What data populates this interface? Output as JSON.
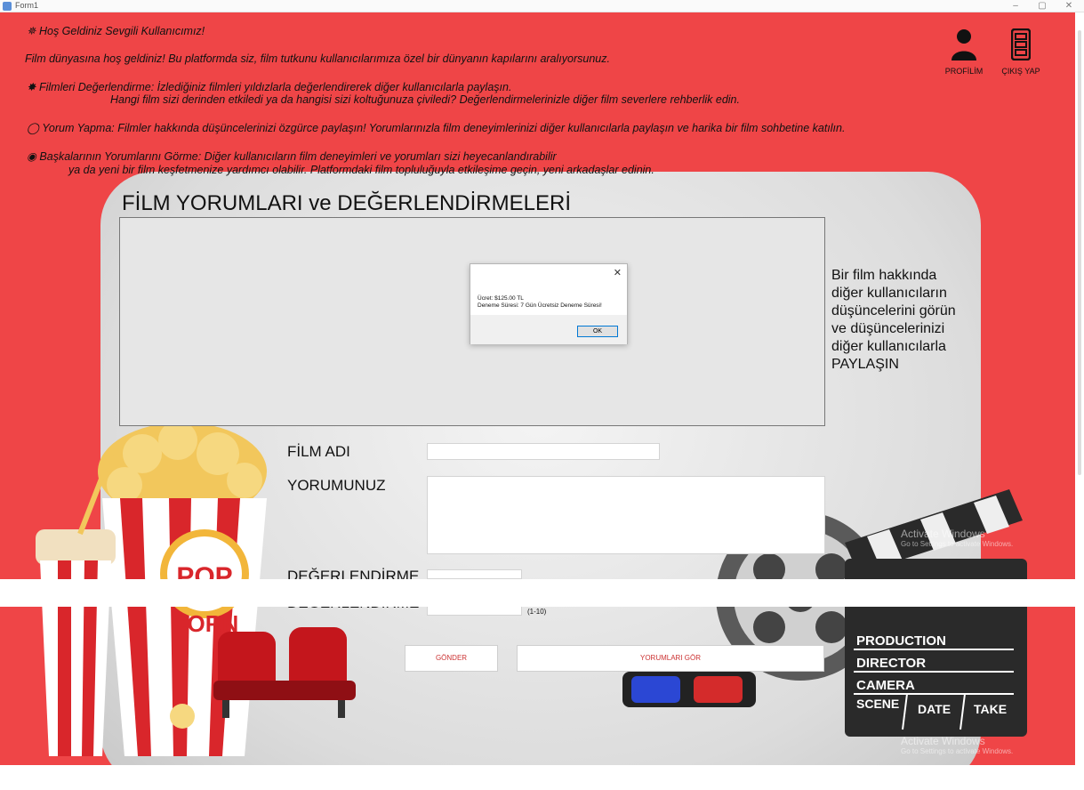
{
  "window": {
    "title": "Form1",
    "minimize": "–",
    "maximize": "▢",
    "close": "✕"
  },
  "intro": {
    "welcome": "Hoş Geldiniz Sevgili Kullanıcımız!",
    "intro_line": "Film dünyasına hoş geldiniz! Bu platformda siz, film tutkunu kullanıcılarımıza özel bir dünyanın kapılarını aralıyorsunuz.",
    "rating_line1": "Filmleri Değerlendirme: İzlediğiniz filmleri yıldızlarla değerlendirerek diğer kullanıcılarla paylaşın.",
    "rating_line2": "Hangi film sizi derinden etkiledi ya da hangisi sizi koltuğunuza çiviledi? Değerlendirmelerinizle diğer film severlere rehberlik edin.",
    "comment_line": "Yorum Yapma: Filmler hakkında düşüncelerinizi özgürce paylaşın! Yorumlarınızla film deneyimlerinizi diğer kullanıcılarla paylaşın ve harika bir film sohbetine katılın.",
    "others_line1": "Başkalarının Yorumlarını Görme: Diğer kullanıcıların film deneyimleri ve yorumları sizi heyecanlandırabilir",
    "others_line2": "ya da yeni bir film keşfetmenize yardımcı olabilir. Platformdaki film topluluğuyla etkileşime geçin, yeni arkadaşlar edinin."
  },
  "header_buttons": {
    "profile": "PROFİLİM",
    "exit": "ÇIKIŞ YAP"
  },
  "main": {
    "heading": "FİLM YORUMLARI ve DEĞERLENDİRMELERİ",
    "side_note": "Bir film hakkında diğer kullanıcıların düşüncelerini görün ve düşüncelerinizi diğer kullanıcılarla PAYLAŞIN",
    "film_label": "FİLM ADI",
    "comment_label": "YORUMUNUZ",
    "rating_label": "DEĞERLENDİRME",
    "rating_label_top": "DEĞERLENDİRME",
    "rating_hint": "(1-10)",
    "film_value": "",
    "comment_value": "",
    "rating_value": "",
    "send_button": "GÖNDER",
    "view_button": "YORUMLARI GÖR"
  },
  "dialog": {
    "line1": "Ücret: $125.00 TL",
    "line2": "Deneme Süresi: 7 Gün Ücretsiz Deneme Süresi!",
    "ok": "OK",
    "close": "✕"
  },
  "decor": {
    "popcorn_text1": "POP",
    "popcorn_text2": "CORN",
    "clapper_production": "PRODUCTION",
    "clapper_director": "DIRECTOR",
    "clapper_camera": "CAMERA",
    "clapper_scene": "SCENE",
    "clapper_date": "DATE",
    "clapper_take": "TAKE"
  },
  "watermark": {
    "title": "Activate Windows",
    "sub": "Go to Settings to activate Windows."
  },
  "colors": {
    "background": "#ef4547",
    "screen": "#e8e8e8",
    "button_text": "#cc3333"
  }
}
